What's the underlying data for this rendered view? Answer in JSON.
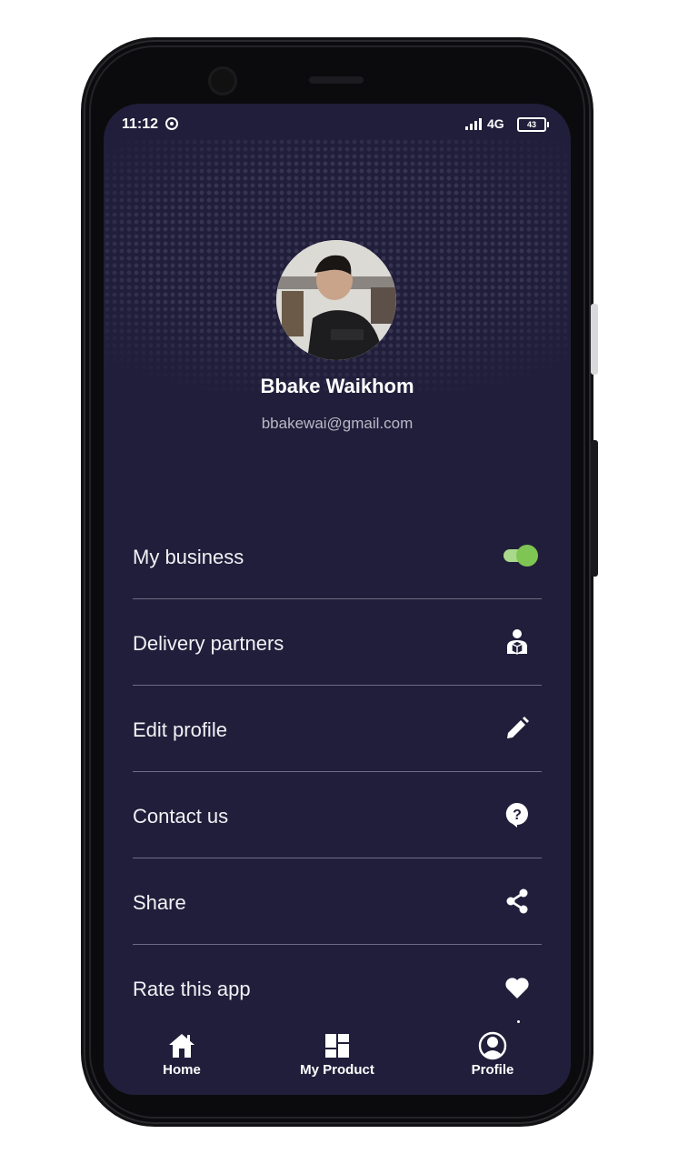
{
  "status_bar": {
    "time": "11:12",
    "network": "4G",
    "battery": "43"
  },
  "profile": {
    "name": "Bbake Waikhom",
    "email": "bbakewai@gmail.com"
  },
  "menu": {
    "items": [
      {
        "label": "My business",
        "control": "toggle",
        "toggle_on": true
      },
      {
        "label": "Delivery partners",
        "icon": "delivery-person-icon"
      },
      {
        "label": "Edit profile",
        "icon": "pencil-icon"
      },
      {
        "label": "Contact us",
        "icon": "help-bubble-icon"
      },
      {
        "label": "Share",
        "icon": "share-icon"
      },
      {
        "label": "Rate this app",
        "icon": "heart-icon"
      }
    ]
  },
  "bottom_nav": {
    "items": [
      {
        "label": "Home",
        "icon": "home-icon"
      },
      {
        "label": "My Product",
        "icon": "dashboard-grid-icon"
      },
      {
        "label": "Profile",
        "icon": "account-circle-icon"
      }
    ]
  },
  "colors": {
    "background": "#201e3a",
    "toggle_accent": "#7fc553",
    "divider": "#6e6c84"
  }
}
